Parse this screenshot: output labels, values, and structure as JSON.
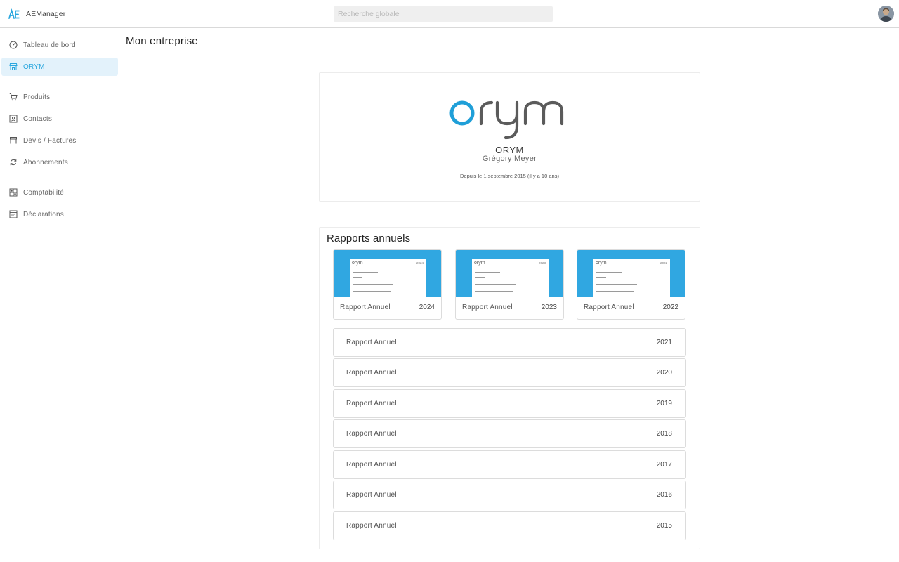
{
  "app": {
    "name": "AEManager"
  },
  "colors": {
    "accent": "#2aa7de",
    "thumb_bg": "#30a7e1",
    "active_bg": "#e3f2fb",
    "logo_gray": "#5b5b5b"
  },
  "search": {
    "placeholder": "Recherche globale",
    "value": ""
  },
  "sidebar": {
    "items": [
      {
        "label": "Tableau de bord",
        "icon": "gauge-icon"
      },
      {
        "label": "ORYM",
        "icon": "store-icon",
        "active": true
      },
      {
        "label": "Produits",
        "icon": "cart-icon"
      },
      {
        "label": "Contacts",
        "icon": "contact-card-icon"
      },
      {
        "label": "Devis / Factures",
        "icon": "invoice-icon"
      },
      {
        "label": "Abonnements",
        "icon": "refresh-icon"
      },
      {
        "label": "Comptabilité",
        "icon": "ledger-icon"
      },
      {
        "label": "Déclarations",
        "icon": "declaration-icon"
      }
    ]
  },
  "main": {
    "title": "Mon entreprise",
    "company": {
      "logo_text": "orym",
      "name": "ORYM",
      "owner": "Grégory Meyer",
      "since": "Depuis le 1 septembre 2015 (il y a 10 ans)"
    },
    "reports": {
      "title": "Rapports annuels",
      "featured": [
        {
          "label": "Rapport Annuel",
          "year": "2024"
        },
        {
          "label": "Rapport Annuel",
          "year": "2023"
        },
        {
          "label": "Rapport Annuel",
          "year": "2022"
        }
      ],
      "list": [
        {
          "label": "Rapport Annuel",
          "year": "2021"
        },
        {
          "label": "Rapport Annuel",
          "year": "2020"
        },
        {
          "label": "Rapport Annuel",
          "year": "2019"
        },
        {
          "label": "Rapport Annuel",
          "year": "2018"
        },
        {
          "label": "Rapport Annuel",
          "year": "2017"
        },
        {
          "label": "Rapport Annuel",
          "year": "2016"
        },
        {
          "label": "Rapport Annuel",
          "year": "2015"
        }
      ]
    }
  }
}
